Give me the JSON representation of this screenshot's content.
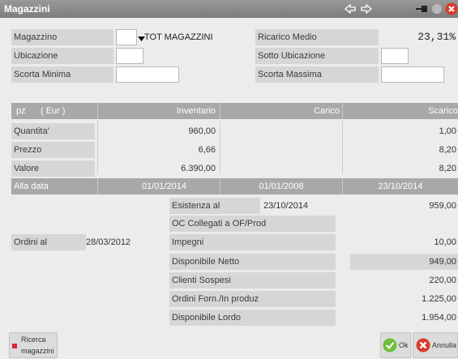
{
  "window": {
    "title": "Magazzini"
  },
  "fields": {
    "magazzino_label": "Magazzino",
    "magazzino_value": "TOT MAGAZZINI",
    "ricarico_label": "Ricarico Medio",
    "ricarico_value": "23,31%",
    "ubicazione_label": "Ubicazione",
    "sotto_ubicazione_label": "Sotto Ubicazione",
    "scorta_minima_label": "Scorta Minima",
    "scorta_massima_label": "Scorta Massima"
  },
  "table": {
    "header": {
      "unit": "pz",
      "currency": "( Eur )",
      "col1": "Inventario",
      "col2": "Carico",
      "col3": "Scarico"
    },
    "rows": [
      {
        "label": "Quantita'",
        "inventario": "960,00",
        "carico": "",
        "scarico": "1,00"
      },
      {
        "label": "Prezzo",
        "inventario": "6,66",
        "carico": "",
        "scarico": "8,20"
      },
      {
        "label": "Valore",
        "inventario": "6.390,00",
        "carico": "",
        "scarico": "8,20"
      }
    ],
    "date_row": {
      "label": "Alla data",
      "d1": "01/01/2014",
      "d2": "01/01/2008",
      "d3": "23/10/2014"
    }
  },
  "summary": {
    "esistenza_label": "Esistenza al",
    "esistenza_date": "23/10/2014",
    "esistenza_value": "959,00",
    "oc_label": "OC Collegati a OF/Prod",
    "ordini_label": "Ordini al",
    "ordini_date": "28/03/2012",
    "impegni_label": "Impegni",
    "impegni_value": "10,00",
    "disp_netto_label": "Disponibile Netto",
    "disp_netto_value": "949,00",
    "clienti_label": "Clienti Sospesi",
    "clienti_value": "220,00",
    "ordini_forn_label": "Ordini Forn./In produz",
    "ordini_forn_value": "1.225,00",
    "disp_lordo_label": "Disponibile Lordo",
    "disp_lordo_value": "1.954,00"
  },
  "footer": {
    "ricerca_line1": "Ricerca",
    "ricerca_line2": "magazzini",
    "ok_label": "Ok",
    "annulla_label": "Annulla"
  },
  "icons": [
    "arrow-left-icon",
    "arrow-right-icon",
    "pin-icon",
    "minimize-icon",
    "close-icon",
    "dropdown-arrow-icon",
    "check-icon",
    "cancel-icon"
  ],
  "colors": {
    "titlebar": "#8a8a8a",
    "header": "#a8a8a8",
    "label_bg": "#d6d6d6",
    "ok_green": "#6cbf3a",
    "close_red": "#d83a2c"
  }
}
